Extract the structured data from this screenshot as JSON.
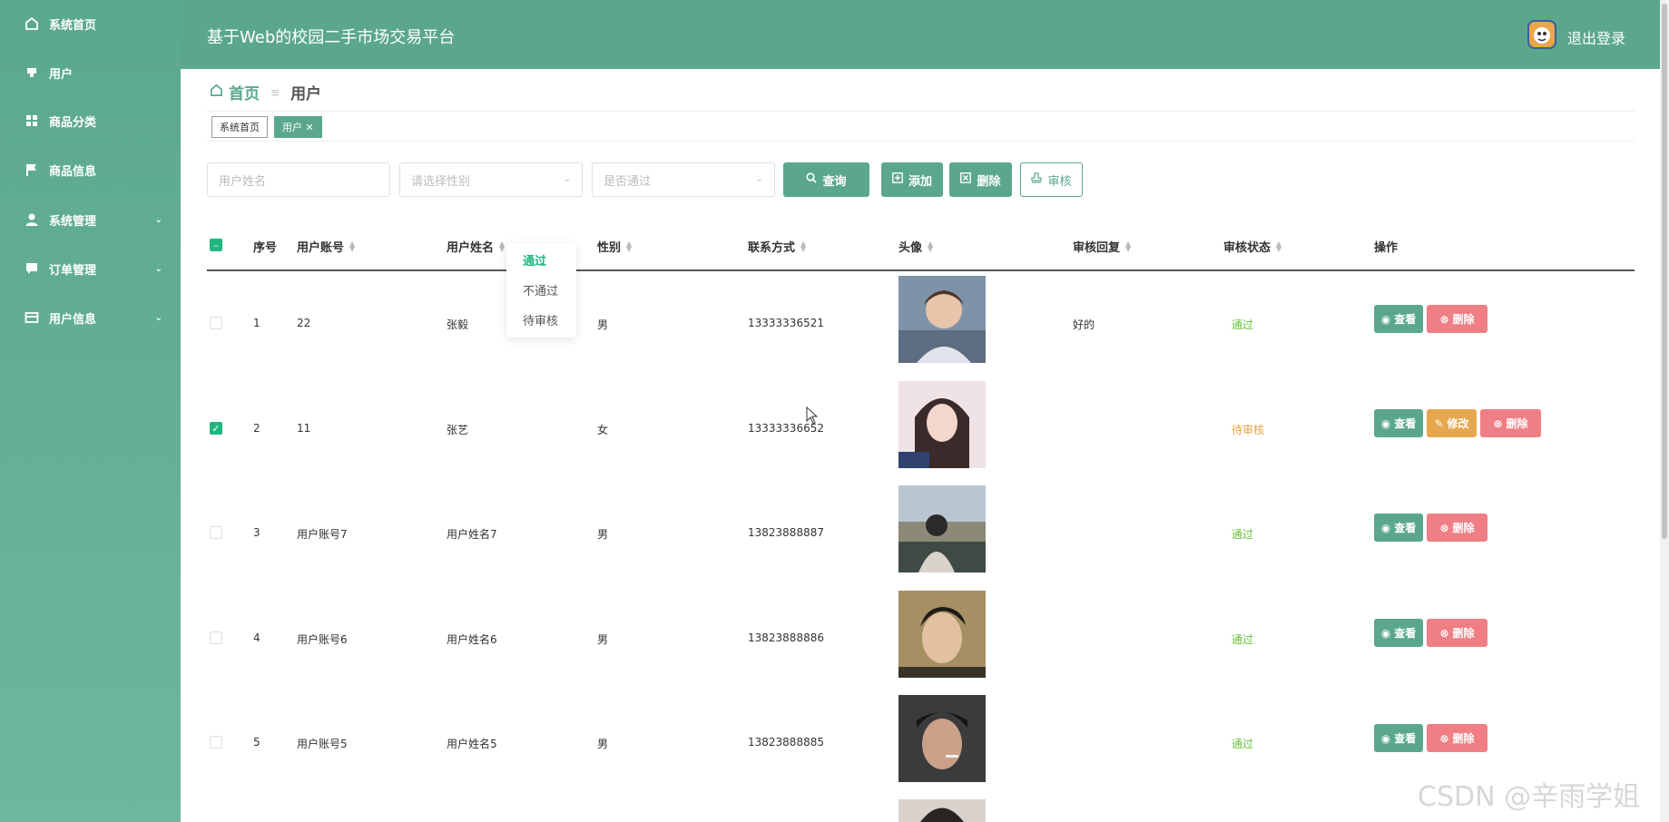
{
  "app": {
    "title": "基于Web的校园二手市场交易平台",
    "logout_label": "退出登录"
  },
  "sidebar": {
    "items": [
      {
        "label": "系统首页",
        "icon": "home-icon"
      },
      {
        "label": "用户",
        "icon": "user-tag-icon"
      },
      {
        "label": "商品分类",
        "icon": "grid-icon"
      },
      {
        "label": "商品信息",
        "icon": "flag-icon"
      },
      {
        "label": "系统管理",
        "icon": "person-icon"
      },
      {
        "label": "订单管理",
        "icon": "comment-icon"
      },
      {
        "label": "用户信息",
        "icon": "card-icon"
      }
    ]
  },
  "breadcrumb": {
    "home": "首页",
    "current": "用户"
  },
  "tabs": [
    {
      "label": "系统首页"
    },
    {
      "label": "用户 ✕"
    }
  ],
  "filters": {
    "name_placeholder": "用户姓名",
    "gender_placeholder": "请选择性别",
    "approved_placeholder": "是否通过"
  },
  "toolbar": {
    "query": "查询",
    "add": "添加",
    "delete": "删除",
    "review": "审核"
  },
  "table": {
    "headers": [
      "序号",
      "用户账号",
      "用户姓名",
      "性别",
      "联系方式",
      "头像",
      "审核回复",
      "审核状态",
      "操作"
    ],
    "rows": [
      {
        "index": "1",
        "account": "22",
        "name": "张毅",
        "gender": "男",
        "phone": "13333336521",
        "reply": "好的",
        "status": "通过",
        "checked": false
      },
      {
        "index": "2",
        "account": "11",
        "name": "张艺",
        "gender": "女",
        "phone": "13333336652",
        "reply": "",
        "status": "待审核",
        "checked": true
      },
      {
        "index": "3",
        "account": "用户账号7",
        "name": "用户姓名7",
        "gender": "男",
        "phone": "13823888887",
        "reply": "",
        "status": "通过",
        "checked": false
      },
      {
        "index": "4",
        "account": "用户账号6",
        "name": "用户姓名6",
        "gender": "男",
        "phone": "13823888886",
        "reply": "",
        "status": "通过",
        "checked": false
      },
      {
        "index": "5",
        "account": "用户账号5",
        "name": "用户姓名5",
        "gender": "男",
        "phone": "13823888885",
        "reply": "",
        "status": "通过",
        "checked": false
      }
    ],
    "actions": {
      "view": "查看",
      "edit": "修改",
      "delete": "删除"
    }
  },
  "status_dropdown": {
    "options": [
      "通过",
      "不通过",
      "待审核"
    ],
    "selected": "通过"
  },
  "colors": {
    "primary": "#5ba78c",
    "approved": "#67c23a",
    "pending": "#e6a23c",
    "danger": "#ef7f85",
    "warning": "#e7a74e"
  },
  "watermark": "CSDN @辛雨学姐"
}
